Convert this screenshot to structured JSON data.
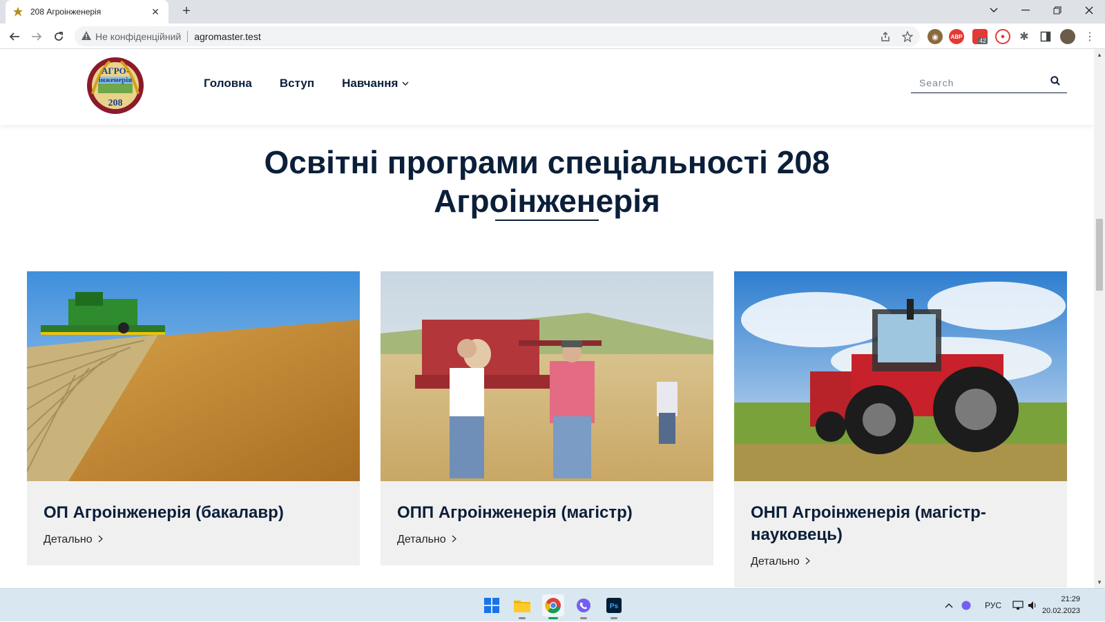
{
  "browser": {
    "tab_title": "208 Агроінженерія",
    "tab_close": "✕",
    "new_tab": "+",
    "security_label": "Не конфіденційний",
    "url": "agromaster.test",
    "extensions": [
      "owl-extension",
      "adblock-extension",
      "tracking-extension",
      "pdf-extension",
      "puzzle-extension",
      "sidepanel",
      "profile"
    ],
    "badge_count": "42",
    "adblock_label": "ABP"
  },
  "site": {
    "nav": [
      "Головна",
      "Вступ",
      "Навчання"
    ],
    "search_placeholder": "Search",
    "logo_text_top": "АГРО-",
    "logo_text_mid": "інженерія",
    "logo_number": "208",
    "section_title_line1": "Освітні програми спеціальності 208",
    "section_title_line2": "Агроінженерія",
    "cards": [
      {
        "title": "ОП Агроінженерія (бакалавр)",
        "link": "Детально"
      },
      {
        "title": "ОПП Агроінженерія (магістр)",
        "link": "Детально"
      },
      {
        "title": "ОНП Агроінженерія (магістр-науковець)",
        "link": "Детально"
      }
    ]
  },
  "taskbar": {
    "language": "РУС",
    "time": "21:29",
    "date": "20.02.2023"
  },
  "colors": {
    "navy": "#0b1f3a",
    "card_bg": "#f0f0f0",
    "taskbar": "#d9e7f1"
  }
}
